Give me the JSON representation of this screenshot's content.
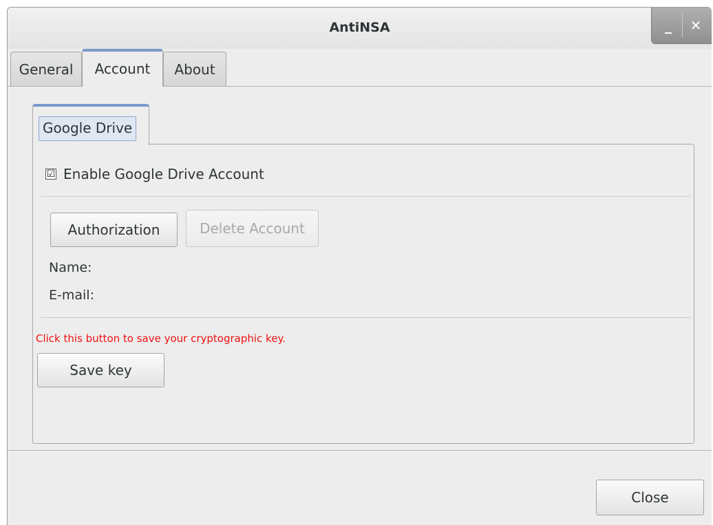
{
  "window": {
    "title": "AntiNSA",
    "minimize_label": "_",
    "close_label": "✕"
  },
  "tabs": [
    {
      "label": "General",
      "active": false
    },
    {
      "label": "Account",
      "active": true
    },
    {
      "label": "About",
      "active": false
    }
  ],
  "account": {
    "subtab_label": "Google Drive",
    "enable_checkbox": {
      "label": "Enable Google Drive Account",
      "checked": true,
      "mark": "☑"
    },
    "authorization_label": "Authorization",
    "delete_account_label": "Delete Account",
    "name_label": "Name:",
    "email_label": "E-mail:",
    "warning_text": "Click this button to save your cryptographic key.",
    "save_key_label": "Save key"
  },
  "footer": {
    "close_label": "Close"
  },
  "colors": {
    "active_tab_accent": "#7a9acb",
    "warning": "#ee1111"
  }
}
